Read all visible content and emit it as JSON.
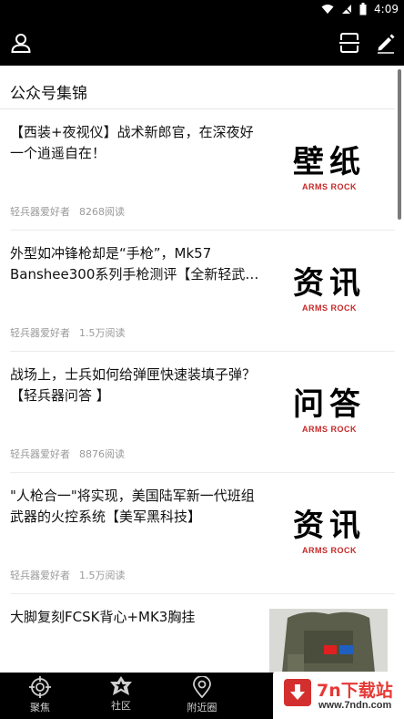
{
  "status_bar": {
    "time": "4:09"
  },
  "toolbar": {
    "left_icon": "user-icon",
    "right_icons": [
      "scan-icon",
      "edit-icon"
    ]
  },
  "section": {
    "title": "公众号集锦"
  },
  "articles": [
    {
      "title": "【西装+夜视仪】战术新郎官，在深夜好一个逍遥自在！",
      "author": "轻兵器爱好者",
      "reads": "8268阅读",
      "thumb_text": "壁纸",
      "thumb_brand": "ARMS ROCK"
    },
    {
      "title": "外型如冲锋枪却是“手枪”，Mk57 Banshee300系列手枪测评【全新轻武…",
      "author": "轻兵器爱好者",
      "reads": "1.5万阅读",
      "thumb_text": "资讯",
      "thumb_brand": "ARMS ROCK"
    },
    {
      "title": "战场上，士兵如何给弹匣快速装填子弹？【轻兵器问答 】",
      "author": "轻兵器爱好者",
      "reads": "8876阅读",
      "thumb_text": "问答",
      "thumb_brand": "ARMS ROCK"
    },
    {
      "title": "\"人枪合一\"将实现，美国陆军新一代班组武器的火控系统【美军黑科技】",
      "author": "轻兵器爱好者",
      "reads": "1.5万阅读",
      "thumb_text": "资讯",
      "thumb_brand": "ARMS ROCK"
    },
    {
      "title": "大脚复刻FCSK背心+MK3胸挂",
      "author": "",
      "reads": ""
    }
  ],
  "bottom_nav": [
    {
      "label": "聚焦",
      "icon": "target-icon"
    },
    {
      "label": "社区",
      "icon": "star-badge-icon"
    },
    {
      "label": "附近圈",
      "icon": "location-pin-icon"
    }
  ],
  "watermark": {
    "name": "7n下载站",
    "url": "www.7ndn.com"
  },
  "colors": {
    "bar_background": "#000000",
    "brand_red": "#c62828",
    "meta_gray": "#9a9a9a"
  }
}
